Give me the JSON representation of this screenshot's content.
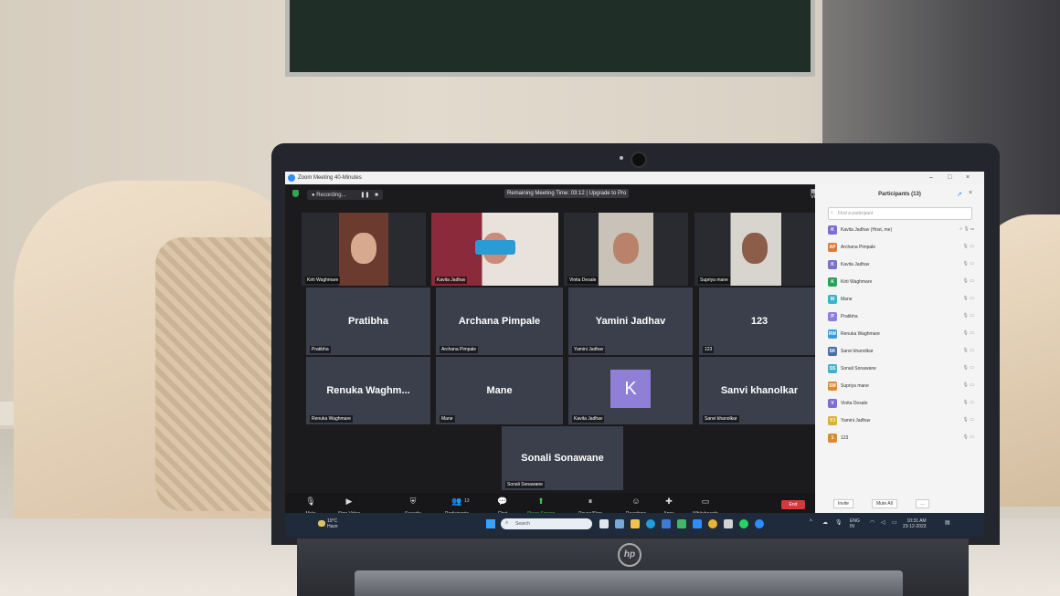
{
  "zoom": {
    "window_title": "Zoom Meeting 40-Minutes",
    "recording_label": "Recording...",
    "remaining_time": "Remaining Meeting Time: 03:12 | Upgrade to Pro",
    "view_label": "View",
    "end_label": "End",
    "toolbar": [
      {
        "icon": "microphone-icon",
        "label": "Mute"
      },
      {
        "icon": "video-camera-icon",
        "label": "Stop Video"
      },
      {
        "icon": "shield-icon",
        "label": "Security"
      },
      {
        "icon": "people-icon",
        "label": "Participants",
        "count": "13"
      },
      {
        "icon": "chat-bubble-icon",
        "label": "Chat"
      },
      {
        "icon": "share-screen-icon",
        "label": "Share Screen"
      },
      {
        "icon": "record-icon",
        "label": "Pause/Stop Recording"
      },
      {
        "icon": "smiley-icon",
        "label": "Reactions"
      },
      {
        "icon": "apps-icon",
        "label": "Apps"
      },
      {
        "icon": "whiteboard-icon",
        "label": "Whiteboards"
      }
    ],
    "tiles": [
      {
        "name": "Kirti Waghmare",
        "display": "",
        "type": "video"
      },
      {
        "name": "Kavita Jadhav",
        "display": "",
        "type": "video"
      },
      {
        "name": "Vinita Desale",
        "display": "",
        "type": "video"
      },
      {
        "name": "Supriya  mane",
        "display": "",
        "type": "video"
      },
      {
        "name": "Pratibha",
        "display": "Pratibha",
        "type": "name"
      },
      {
        "name": "Archana Pimpale",
        "display": "Archana Pimpale",
        "type": "name"
      },
      {
        "name": "Yamini Jadhav",
        "display": "Yamini Jadhav",
        "type": "name"
      },
      {
        "name": "123",
        "display": "123",
        "type": "name"
      },
      {
        "name": "Renuka Waghmare",
        "display": "Renuka  Waghm...",
        "type": "name"
      },
      {
        "name": "Mane",
        "display": "Mane",
        "type": "name"
      },
      {
        "name": "Kavita Jadhav",
        "display": "K",
        "type": "avatar"
      },
      {
        "name": "Sanvi khanolkar",
        "display": "Sanvi khanolkar",
        "type": "name"
      },
      {
        "name": "Sonali Sonawane",
        "display": "Sonali Sonawane",
        "type": "name"
      }
    ]
  },
  "participants_panel": {
    "title": "Participants (13)",
    "search_placeholder": "Find a participant",
    "invite_label": "Invite",
    "mute_all_label": "Mute All",
    "list": [
      {
        "initials": "K",
        "name": "Kavita Jadhav (Host, me)",
        "color": "#7b6fd0"
      },
      {
        "initials": "AP",
        "name": "Archana Pimpale",
        "color": "#e07b39"
      },
      {
        "initials": "K",
        "name": "Kavita Jadhav",
        "color": "#7b6fd0"
      },
      {
        "initials": "K",
        "name": "Kirti Waghmare",
        "color": "#2e9e5b"
      },
      {
        "initials": "M",
        "name": "Mane",
        "color": "#3cb4c9"
      },
      {
        "initials": "P",
        "name": "Pratibha",
        "color": "#8f7fd6"
      },
      {
        "initials": "RW",
        "name": "Renuka Waghmare",
        "color": "#3b9ad9"
      },
      {
        "initials": "SK",
        "name": "Sanvi khanolkar",
        "color": "#4a6fa8"
      },
      {
        "initials": "SS",
        "name": "Sonali Sonawane",
        "color": "#3cb4c9"
      },
      {
        "initials": "SM",
        "name": "Supriya  mane",
        "color": "#d98a3b"
      },
      {
        "initials": "V",
        "name": "Vinita Desale",
        "color": "#7b6fd0"
      },
      {
        "initials": "YJ",
        "name": "Yamini Jadhav",
        "color": "#d6b23b"
      },
      {
        "initials": "1",
        "name": "123",
        "color": "#d98a3b"
      }
    ]
  },
  "taskbar": {
    "weather_temp": "19°C",
    "weather_desc": "Haze",
    "search_placeholder": "Search",
    "lang": "ENG",
    "region": "IN",
    "time": "10:31 AM",
    "date": "23-12-2023"
  },
  "laptop_brand": "hp"
}
